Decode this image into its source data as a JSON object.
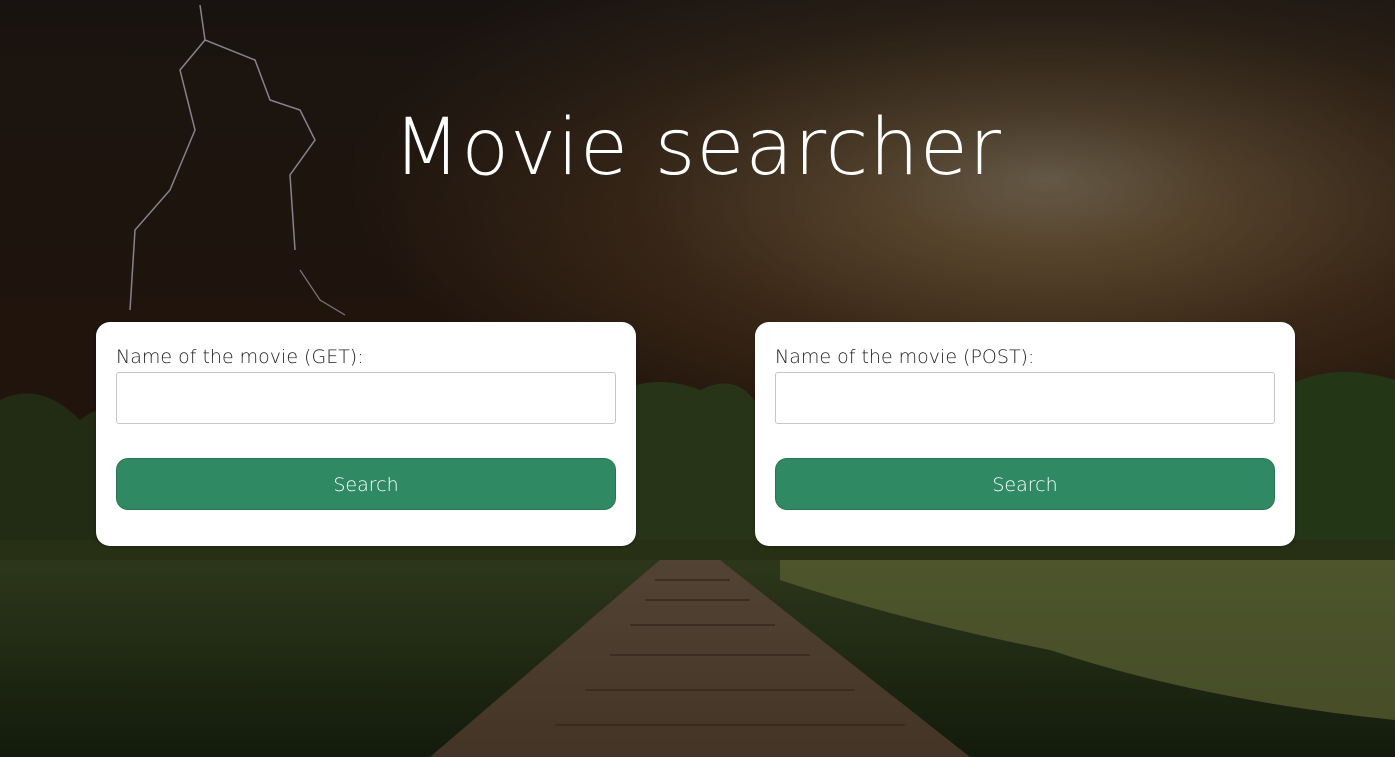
{
  "page": {
    "title": "Movie searcher"
  },
  "forms": [
    {
      "label": "Name of the movie (GET):",
      "input_value": "",
      "button_label": "Search"
    },
    {
      "label": "Name of the movie (POST):",
      "input_value": "",
      "button_label": "Search"
    }
  ],
  "colors": {
    "button_bg": "#2f8a63",
    "card_bg": "#ffffff",
    "title_text": "#ffffff"
  },
  "background": {
    "description_icon": "landscape-photo-background"
  }
}
